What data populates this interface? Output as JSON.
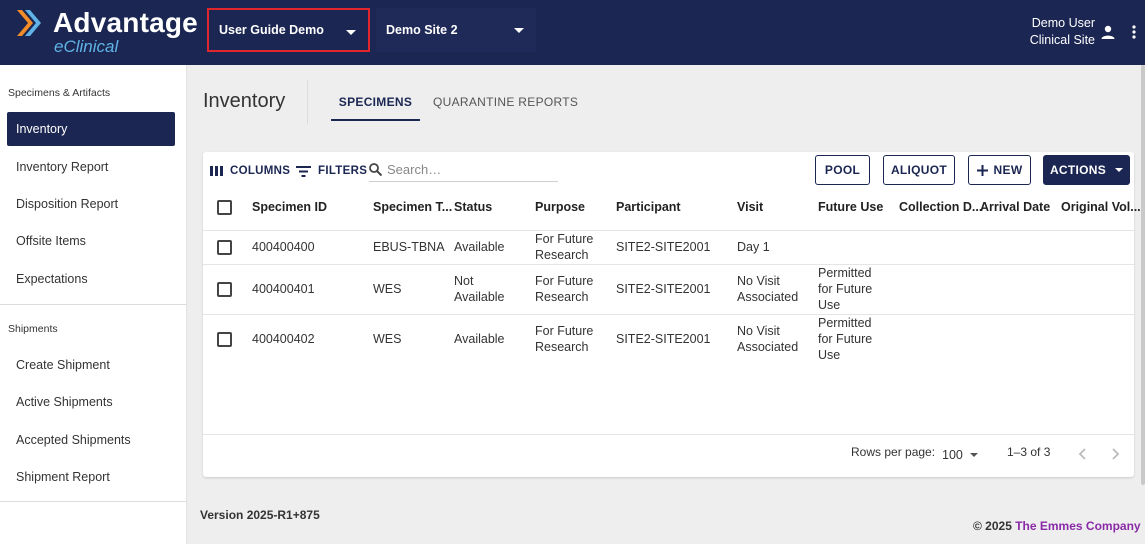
{
  "brand": {
    "name": "Advantage",
    "subtitle": "eClinical"
  },
  "header": {
    "study_select": "User Guide Demo",
    "site_select": "Demo Site 2",
    "user_name": "Demo User",
    "user_role": "Clinical Site"
  },
  "sidebar": {
    "section1": "Specimens & Artifacts",
    "items1": [
      "Inventory",
      "Inventory Report",
      "Disposition Report",
      "Offsite Items",
      "Expectations"
    ],
    "section2": "Shipments",
    "items2": [
      "Create Shipment",
      "Active Shipments",
      "Accepted Shipments",
      "Shipment Report"
    ]
  },
  "main": {
    "title": "Inventory",
    "tabs": [
      "SPECIMENS",
      "QUARANTINE REPORTS"
    ]
  },
  "toolbar": {
    "columns": "COLUMNS",
    "filters": "FILTERS",
    "search_placeholder": "Search…",
    "pool": "POOL",
    "aliquot": "ALIQUOT",
    "new": "NEW",
    "actions": "ACTIONS"
  },
  "table": {
    "headers": [
      "Specimen ID",
      "Specimen T...",
      "Status",
      "Purpose",
      "Participant",
      "Visit",
      "Future Use",
      "Collection D...",
      "Arrival Date",
      "Original Vol..."
    ],
    "rows": [
      {
        "id": "400400400",
        "type": "EBUS-TBNA",
        "status": [
          "Available"
        ],
        "purpose": [
          "For Future",
          "Research"
        ],
        "participant": "SITE2-SITE2001",
        "visit": [
          "Day 1"
        ],
        "future_use": []
      },
      {
        "id": "400400401",
        "type": "WES",
        "status": [
          "Not",
          "Available"
        ],
        "purpose": [
          "For Future",
          "Research"
        ],
        "participant": "SITE2-SITE2001",
        "visit": [
          "No Visit",
          "Associated"
        ],
        "future_use": [
          "Permitted",
          "for Future",
          "Use"
        ]
      },
      {
        "id": "400400402",
        "type": "WES",
        "status": [
          "Available"
        ],
        "purpose": [
          "For Future",
          "Research"
        ],
        "participant": "SITE2-SITE2001",
        "visit": [
          "No Visit",
          "Associated"
        ],
        "future_use": [
          "Permitted",
          "for Future",
          "Use"
        ]
      }
    ]
  },
  "pagination": {
    "rows_per_page_label": "Rows per page:",
    "rows_per_page": "100",
    "range": "1–3 of 3"
  },
  "footer": {
    "version": "Version 2025-R1+875",
    "copyright": "© 2025",
    "company": "The Emmes Company"
  },
  "colors": {
    "navy": "#1b2652",
    "highlight": "#e0262d",
    "logo_orange": "#f28c28",
    "logo_blue": "#5fb3e6",
    "company_purple": "#8a2aa8"
  }
}
